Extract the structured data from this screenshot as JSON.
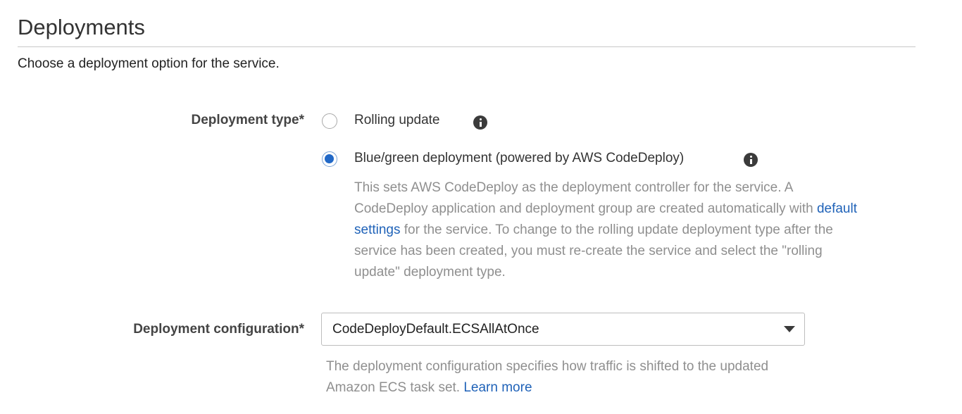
{
  "section": {
    "title": "Deployments",
    "description": "Choose a deployment option for the service."
  },
  "deployment_type": {
    "label": "Deployment type*",
    "options": [
      {
        "label": "Rolling update",
        "selected": false
      },
      {
        "label": "Blue/green deployment (powered by AWS CodeDeploy)",
        "selected": true
      }
    ],
    "help": {
      "part1": "This sets AWS CodeDeploy as the deployment controller for the service. A CodeDeploy application and deployment group are created automatically with ",
      "link": "default settings",
      "part2": " for the service. To change to the rolling update deployment type after the service has been created, you must re-create the service and select the \"rolling update\" deployment type."
    }
  },
  "deployment_configuration": {
    "label": "Deployment configuration*",
    "value": "CodeDeployDefault.ECSAllAtOnce",
    "help": {
      "text": "The deployment configuration specifies how traffic is shifted to the updated Amazon ECS task set. ",
      "link": "Learn more"
    }
  },
  "colors": {
    "link": "#1f62b8",
    "radio_selected": "#2168c7",
    "help_text": "#8f8f8f"
  },
  "icons": {
    "info": "info-icon",
    "dropdown": "caret-down-icon"
  }
}
